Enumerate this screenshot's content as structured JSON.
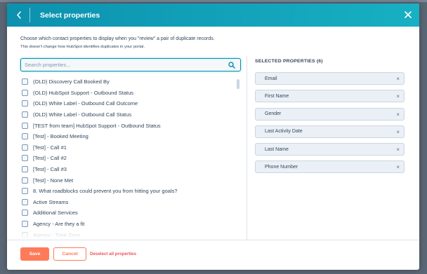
{
  "header": {
    "title": "Select properties",
    "bg_gradient": [
      "#0c91ae",
      "#18b0c3"
    ]
  },
  "description": {
    "line1": "Choose which contact properties to display when you \"review\" a pair of duplicate records.",
    "line2": "This doesn't change how HubSpot identifies duplicates in your portal."
  },
  "search": {
    "placeholder": "Search properties...",
    "value": ""
  },
  "properties": [
    {
      "label": "(OLD) Discovery Call Booked By",
      "checked": false
    },
    {
      "label": "(OLD) HubSpot Support - Outbound Status",
      "checked": false
    },
    {
      "label": "(OLD) White Label - Outbound Call Outcome",
      "checked": false
    },
    {
      "label": "(OLD) White Label - Outbound Call Status",
      "checked": false
    },
    {
      "label": "[TEST from team] HubSpot Support - Outbound Status",
      "checked": false
    },
    {
      "label": "[Test] - Booked Meeting",
      "checked": false
    },
    {
      "label": "[Test] - Call #1",
      "checked": false
    },
    {
      "label": "[Test] - Call #2",
      "checked": false
    },
    {
      "label": "[Test] - Call #3",
      "checked": false
    },
    {
      "label": "[Test] - None Met",
      "checked": false
    },
    {
      "label": "8. What roadblocks could prevent you from hitting your goals?",
      "checked": false
    },
    {
      "label": "Active Streams",
      "checked": false
    },
    {
      "label": "Additional Services",
      "checked": false
    },
    {
      "label": "Agency - Are they a fit",
      "checked": false
    },
    {
      "label": "Agency - Time Zone",
      "checked": false
    }
  ],
  "selected": {
    "heading": "SELECTED PROPERTIES (6)",
    "items": [
      {
        "label": "Email",
        "remove": "×"
      },
      {
        "label": "First Name",
        "remove": "×"
      },
      {
        "label": "Gender",
        "remove": "×"
      },
      {
        "label": "Last Activity Date",
        "remove": "×"
      },
      {
        "label": "Last Name",
        "remove": "×"
      },
      {
        "label": "Phone Number",
        "remove": "×"
      }
    ]
  },
  "footer": {
    "save_label": "Save",
    "cancel_label": "Cancel",
    "deselect_label": "Deselect all properties"
  },
  "colors": {
    "accent_orange": "#ff7a59",
    "link_red": "#f2545b",
    "text": "#33475b",
    "chip_bg": "#eaf0f6"
  },
  "icons": {
    "back": "chevron-left-icon",
    "close": "close-icon",
    "search": "search-icon"
  }
}
